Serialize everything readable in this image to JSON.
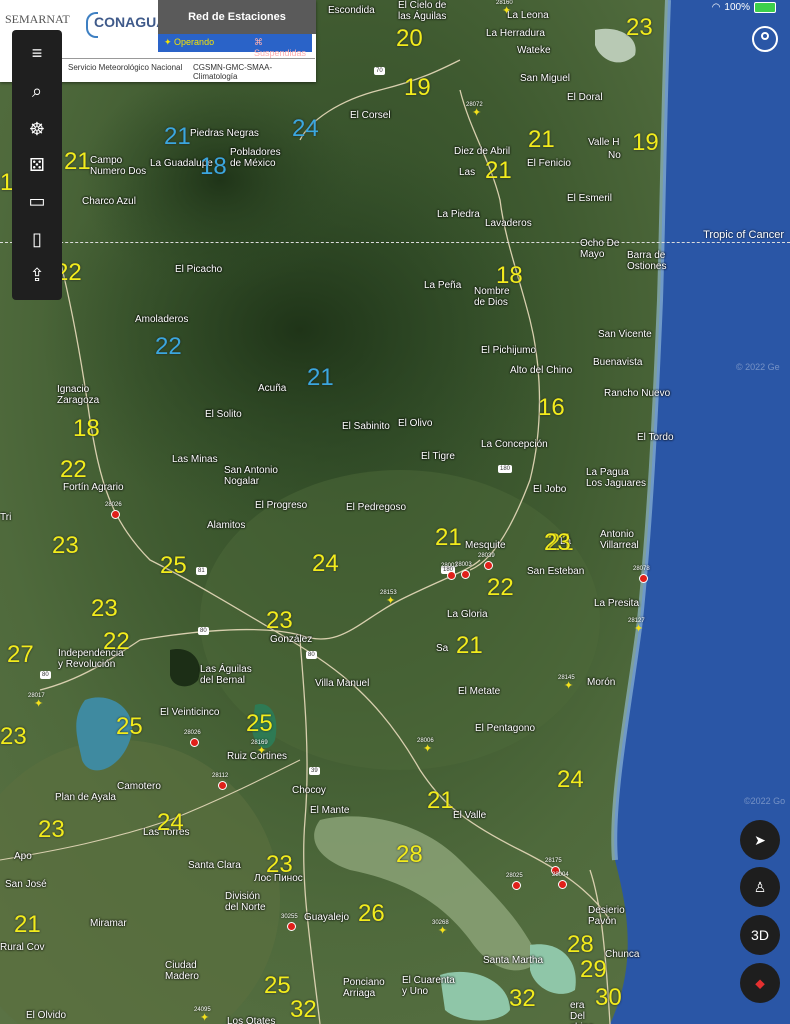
{
  "legend": {
    "logo_left": "SEMARNAT",
    "logo_right": "CONAGUA",
    "title": "Red de Estaciones Climatológicas",
    "key_operating": "Operando",
    "key_suspended": "Suspendidas",
    "subtitle_left": "Servicio Meteorológico Nacional",
    "subtitle_right": "CGSMN-GMC-SMAA-Climatología"
  },
  "status": {
    "battery": "100%"
  },
  "tropic_label": "Tropic of Cancer",
  "watermarks": [
    "© 2022 Ge",
    "©2022 Go"
  ],
  "toolbar_icons": [
    "menu-icon",
    "search-icon",
    "voyager-icon",
    "dice-icon",
    "ruler-icon",
    "screenshot-icon",
    "share-icon"
  ],
  "controls": {
    "threed": "3D"
  },
  "places": [
    "Escondida",
    "El Cielo de\nlas Águilas",
    "La Leona",
    "La Herradura",
    "Wateke",
    "San Miguel",
    "El Doral",
    "El Corsel",
    "Diez de Abril",
    "El Fenicio",
    "Las",
    "Valle H",
    "No",
    "Piedras Negras",
    "Pobladores\nde México",
    "La Guadalupe",
    "Campo\nNumero Dos",
    "Charco Azul",
    "El Esmeril",
    "La Piedra",
    "Lavaderos",
    "Ocho De\nMayo",
    "Barra de\nOstiones",
    "El Picacho",
    "La Peña",
    "Nombre\nde Dios",
    "Amoladeros",
    "San Vicente",
    "El Pichijumo",
    "Buenavista",
    "Alto del Chino",
    "Rancho Nuevo",
    "Ignacio\nZaragoza",
    "Acuña",
    "El Solito",
    "El Sabinito",
    "El Olivo",
    "El Tordo",
    "La Concepción",
    "Las Minas",
    "San Antonio\nNogalar",
    "El Tigre",
    "La Pagua\nLos Jaguares",
    "Fortín Agrario",
    "El Jobo",
    "El Progreso",
    "El Pedregoso",
    "Alamitos",
    "Mesquite",
    "La",
    "Antonio\nVillarreal",
    "San Esteban",
    "La Presita",
    "La Gloria",
    "González",
    "Sa",
    "Independencia\ny Revolución",
    "Las Águilas\ndel Bernal",
    "Villa Manuel",
    "Morón",
    "El Metate",
    "El Veinticinco",
    "El Pentagono",
    "Ruiz Cortines",
    "Camotero",
    "Chocoy",
    "Plan de Ayala",
    "El Mante",
    "El Valle",
    "Las Torres",
    "Apo",
    "Santa Clara",
    "Лос Пинос",
    "San José",
    "División\ndel Norte",
    "Guayalejo",
    "Desierio\nPavón",
    "Miramar",
    "Santa Martha",
    "Chunca",
    "Ciudad\nMadero",
    "Ponciano\nArriaga",
    "El Cuarenta\ny Uno",
    "El Olvido",
    "Los Otates",
    "Rural Cov",
    "era\nDel\nchipa",
    "Tri",
    "at"
  ],
  "temperatures": [
    "20",
    "23",
    "19",
    "21",
    "19",
    "21",
    "18",
    "21",
    "22",
    "18",
    "21",
    "24",
    "18",
    "22",
    "21",
    "16",
    "18",
    "21",
    "22",
    "23",
    "21",
    "23",
    "25",
    "24",
    "22",
    "23",
    "23",
    "22",
    "21",
    "27",
    "25",
    "25",
    "23",
    "24",
    "21",
    "24",
    "23",
    "28",
    "23",
    "26",
    "21",
    "28",
    "29",
    "25",
    "32",
    "32",
    "30"
  ],
  "highway_shields": [
    "70",
    "180",
    "81",
    "80",
    "80",
    "80",
    "39",
    "180"
  ],
  "station_ids": [
    "28160",
    "28072",
    "28026",
    "28039",
    "28003",
    "28153",
    "28078",
    "28127",
    "28145",
    "28017",
    "28026",
    "28169",
    "28112",
    "28006",
    "28175",
    "28025",
    "28004",
    "30255",
    "30268",
    "24095",
    "28003"
  ]
}
